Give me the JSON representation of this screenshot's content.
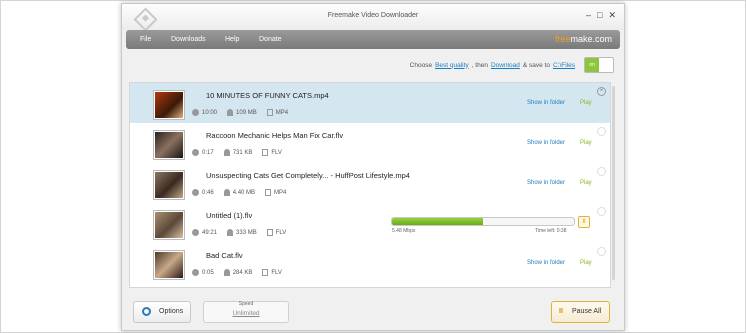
{
  "window": {
    "title": "Freemake Video Downloader",
    "controls": [
      "–",
      "□",
      "✕"
    ]
  },
  "menu": {
    "items": [
      "File",
      "Downloads",
      "Help",
      "Donate"
    ],
    "brand_part1": "free",
    "brand_part2": "make.com"
  },
  "options": {
    "choose_label": "Choose",
    "quality": "Best quality",
    "then_label": ", then",
    "action": "Download",
    "save_label": "& save to",
    "folder": "C:\\Files",
    "toggle_on": "on"
  },
  "downloads": [
    {
      "name": "10 MINUTES OF FUNNY CATS.mp4",
      "duration": "10:00",
      "size": "109 MB",
      "format": "MP4",
      "show_label": "Show in folder",
      "play_label": "Play",
      "selected": true,
      "thumb_color": "#8a2a10"
    },
    {
      "name": "Raccoon Mechanic Helps Man Fix Car.flv",
      "duration": "0:17",
      "size": "731 KB",
      "format": "FLV",
      "show_label": "Show in folder",
      "play_label": "Play",
      "selected": false,
      "thumb_color": "#3a3028"
    },
    {
      "name": "Unsuspecting Cats Get Completely... - HuffPost Lifestyle.mp4",
      "duration": "0:46",
      "size": "4.40 MB",
      "format": "MP4",
      "show_label": "Show in folder",
      "play_label": "Play",
      "selected": false,
      "thumb_color": "#6a5848"
    },
    {
      "name": "Untitled (1).flv",
      "duration": "49:21",
      "size": "333 MB",
      "format": "FLV",
      "progress": 0.5,
      "speed_text": "5.48 Mbps",
      "time_left": "Time left: 0:38",
      "selected": false,
      "thumb_color": "#7a6a58"
    },
    {
      "name": "Bad Cat.flv",
      "duration": "0:05",
      "size": "284 KB",
      "format": "FLV",
      "show_label": "Show in folder",
      "play_label": "Play",
      "selected": false,
      "thumb_color": "#5a4a3a"
    }
  ],
  "bottom": {
    "options_label": "Options",
    "speed_label": "Speed",
    "speed_value": "Unlimited",
    "pause_all_label": "Pause All"
  }
}
